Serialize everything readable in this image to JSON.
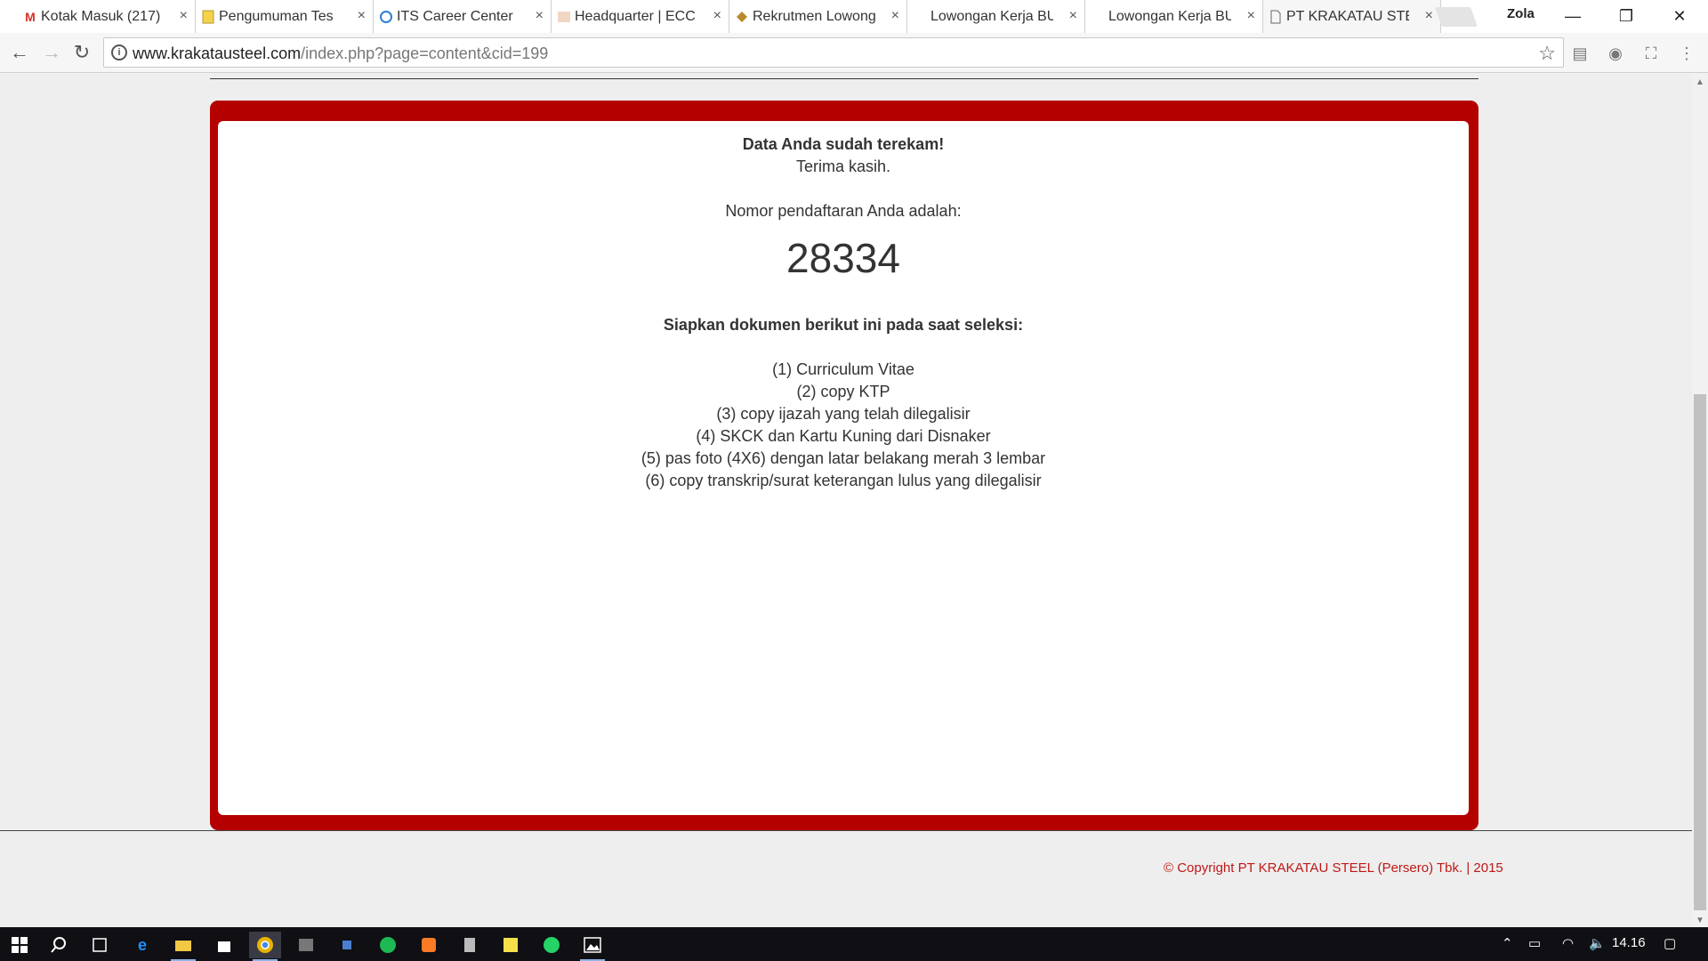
{
  "browser": {
    "tabs": [
      {
        "title": "Kotak Masuk (217)",
        "icon": "gmail-icon"
      },
      {
        "title": "Pengumuman Tes",
        "icon": "document-icon"
      },
      {
        "title": "ITS Career Center",
        "icon": "its-icon"
      },
      {
        "title": "Headquarter | ECC",
        "icon": "ecc-icon"
      },
      {
        "title": "Rekrutmen Lowongan",
        "icon": "garuda-icon"
      },
      {
        "title": "Lowongan Kerja BUMN",
        "icon": "none"
      },
      {
        "title": "Lowongan Kerja BUMN",
        "icon": "none"
      },
      {
        "title": "PT KRAKATAU STEEL",
        "icon": "page-icon",
        "active": true
      }
    ],
    "close_glyph": "×",
    "profile_name": "Zola",
    "url_host": "www.krakatausteel.com",
    "url_path": "/index.php?page=content&cid=199"
  },
  "page": {
    "recorded_title": "Data Anda sudah terekam!",
    "thanks": "Terima kasih.",
    "reg_label": "Nomor pendaftaran Anda adalah:",
    "reg_number": "28334",
    "docs_title": "Siapkan dokumen berikut ini pada saat seleksi:",
    "documents": [
      "(1) Curriculum Vitae",
      "(2) copy KTP",
      "(3) copy ijazah yang telah dilegalisir",
      "(4) SKCK dan Kartu Kuning dari Disnaker",
      "(5) pas foto (4X6) dengan latar belakang merah 3 lembar",
      "(6) copy transkrip/surat keterangan lulus yang dilegalisir"
    ],
    "copyright": "© Copyright PT KRAKATAU STEEL (Persero) Tbk. | 2015"
  },
  "taskbar": {
    "clock": "14.16"
  },
  "colors": {
    "brand_red": "#b50000",
    "copyright_red": "#c01818"
  }
}
